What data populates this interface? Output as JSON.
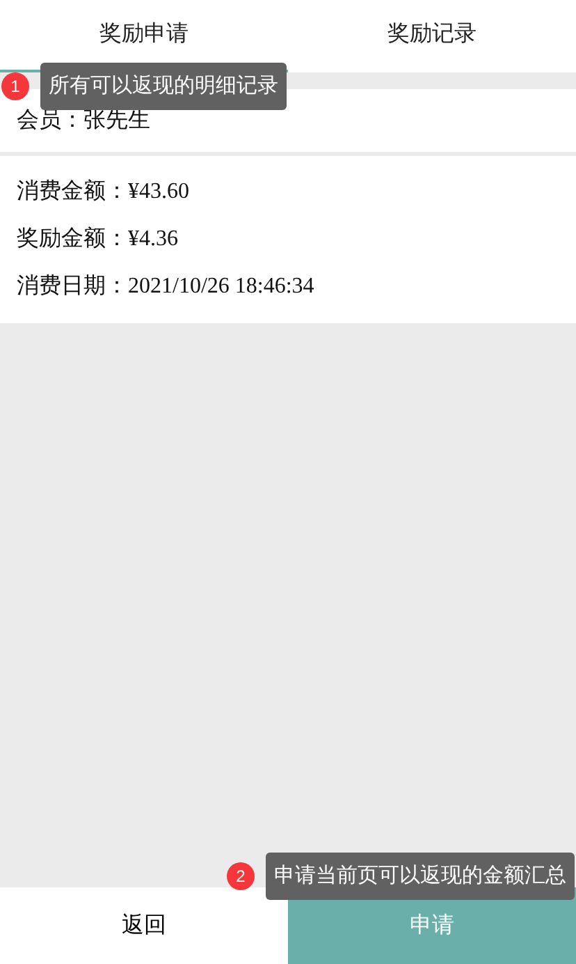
{
  "tabs": [
    {
      "label": "奖励申请",
      "selected": true
    },
    {
      "label": "奖励记录",
      "selected": false
    }
  ],
  "member": {
    "label": "会员：",
    "value": "张先生"
  },
  "record": [
    {
      "label": "消费金额：",
      "value": "¥43.60"
    },
    {
      "label": "奖励金额：",
      "value": "¥4.36"
    },
    {
      "label": "消费日期：",
      "value": "2021/10/26 18:46:34"
    }
  ],
  "buttons": [
    {
      "label": "返回",
      "kind": "secondary"
    },
    {
      "label": "申请",
      "kind": "primary"
    }
  ],
  "hints": [
    {
      "number": "1",
      "text": "所有可以返现的明细记录"
    },
    {
      "number": "2",
      "text": "申请当前页可以返现的金额汇总"
    }
  ]
}
